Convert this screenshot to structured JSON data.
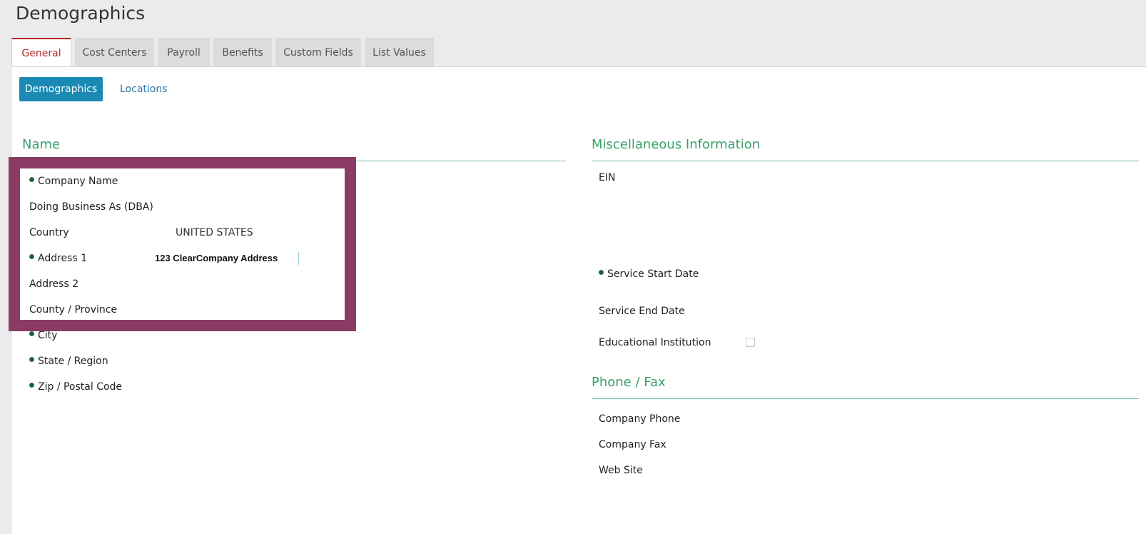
{
  "page": {
    "title": "Demographics"
  },
  "tabs": [
    {
      "label": "General",
      "active": true
    },
    {
      "label": "Cost Centers"
    },
    {
      "label": "Payroll"
    },
    {
      "label": "Benefits"
    },
    {
      "label": "Custom Fields"
    },
    {
      "label": "List Values"
    }
  ],
  "subnav": {
    "active": "Demographics",
    "link": "Locations"
  },
  "name_section": {
    "title": "Name",
    "fields": {
      "company_name": "Company Name",
      "dba": "Doing Business As (DBA)",
      "country": "Country",
      "country_value": "UNITED STATES",
      "address1": "Address 1",
      "address1_value": "123 ClearCompany Address",
      "address2": "Address 2",
      "county": "County / Province",
      "city": "City",
      "state": "State / Region",
      "zip": "Zip / Postal Code"
    }
  },
  "misc_section": {
    "title": "Miscellaneous Information",
    "fields": {
      "ein": "EIN",
      "service_start": "Service Start Date",
      "service_end": "Service End Date",
      "edu": "Educational Institution"
    }
  },
  "phone_section": {
    "title": "Phone / Fax",
    "fields": {
      "phone": "Company Phone",
      "fax": "Company Fax",
      "web": "Web Site"
    }
  },
  "colors": {
    "accent_green": "#3aa06b",
    "active_tab": "#b52a2a",
    "subnav_blue": "#1a8ab5",
    "highlight": "#8a3c66"
  }
}
